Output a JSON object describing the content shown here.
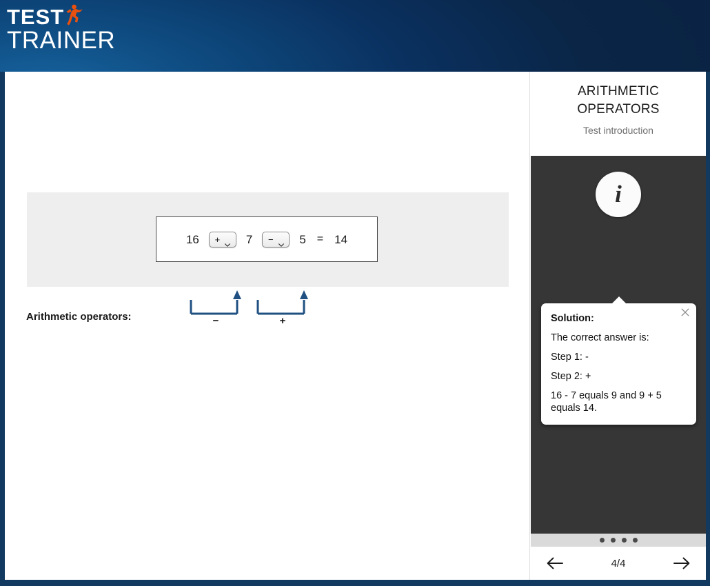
{
  "brand": {
    "line1": "TEST",
    "line2": "TRAINER",
    "mark_icon": "runner-figure-icon",
    "accent_color": "#e8500f",
    "header_color": "#0b2545"
  },
  "exercise": {
    "equation": {
      "terms": [
        "16",
        "7",
        "5"
      ],
      "result_sign": "=",
      "result": "14",
      "operators": [
        {
          "value": "+",
          "name": "operator-select-1",
          "options": [
            "+",
            "−",
            "×",
            "÷"
          ]
        },
        {
          "value": "−",
          "name": "operator-select-2",
          "options": [
            "+",
            "−",
            "×",
            "÷"
          ]
        }
      ]
    },
    "annotations": [
      {
        "label": "−",
        "arrow_color": "#1f5081"
      },
      {
        "label": "+",
        "arrow_color": "#1f5081"
      }
    ],
    "operators_label": "Arithmetic operators:"
  },
  "panel": {
    "title": "ARITHMETIC OPERATORS",
    "subtitle": "Test introduction",
    "info_button_icon": "info-icon",
    "info_button_glyph": "i",
    "tooltip": {
      "close_icon": "close-icon",
      "heading": "Solution:",
      "lines": [
        "The correct answer is:",
        "Step 1: -",
        "Step 2: +",
        "16 - 7 equals 9 and 9 + 5 equals 14."
      ]
    },
    "progress": {
      "dots": 4,
      "current": 4,
      "counter": "4/4"
    },
    "nav": {
      "prev_icon": "arrow-left-icon",
      "next_icon": "arrow-right-icon"
    }
  }
}
